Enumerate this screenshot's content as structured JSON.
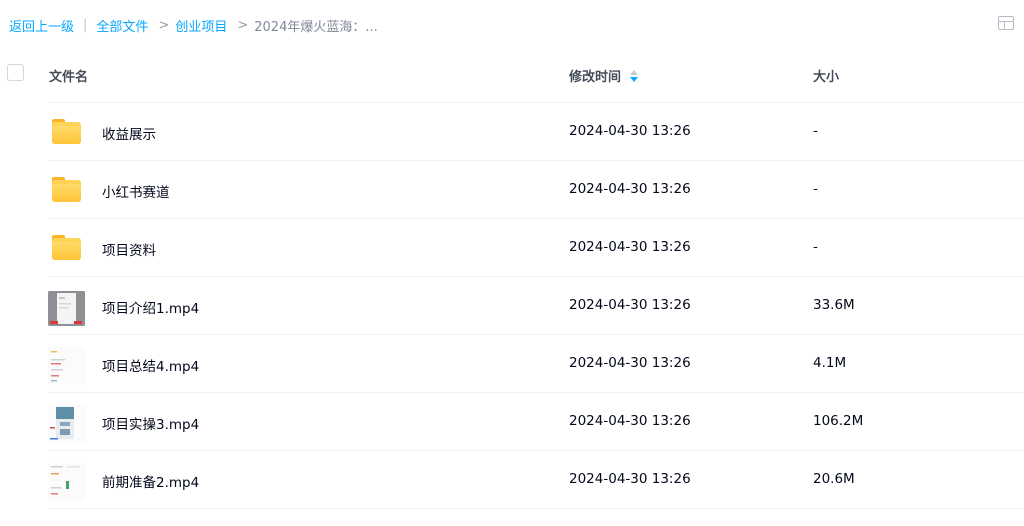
{
  "breadcrumb": {
    "back": "返回上一级",
    "separator": "|",
    "all_files": "全部文件",
    "arrow": ">",
    "level1": "创业项目",
    "current": "2024年爆火蓝海：..."
  },
  "columns": {
    "name": "文件名",
    "modified": "修改时间",
    "size": "大小"
  },
  "sort": {
    "column": "modified",
    "direction": "descending"
  },
  "rows": [
    {
      "name": "收益展示",
      "modified": "2024-04-30 13:26",
      "size": "-",
      "type": "folder"
    },
    {
      "name": "小红书赛道",
      "modified": "2024-04-30 13:26",
      "size": "-",
      "type": "folder"
    },
    {
      "name": "项目资料",
      "modified": "2024-04-30 13:26",
      "size": "-",
      "type": "folder"
    },
    {
      "name": "项目介绍1.mp4",
      "modified": "2024-04-30 13:26",
      "size": "33.6M",
      "type": "video"
    },
    {
      "name": "项目总结4.mp4",
      "modified": "2024-04-30 13:26",
      "size": "4.1M",
      "type": "video"
    },
    {
      "name": "项目实操3.mp4",
      "modified": "2024-04-30 13:26",
      "size": "106.2M",
      "type": "video"
    },
    {
      "name": "前期准备2.mp4",
      "modified": "2024-04-30 13:26",
      "size": "20.6M",
      "type": "video"
    }
  ],
  "colors": {
    "accent": "#06a7ff",
    "folder": "#fbc22c",
    "divider": "#f1f2f4"
  },
  "icons": {
    "folder": "folder-icon",
    "video": "video-thumbnail",
    "view_toggle": "grid-view-icon",
    "sort": "sort-desc-icon"
  }
}
